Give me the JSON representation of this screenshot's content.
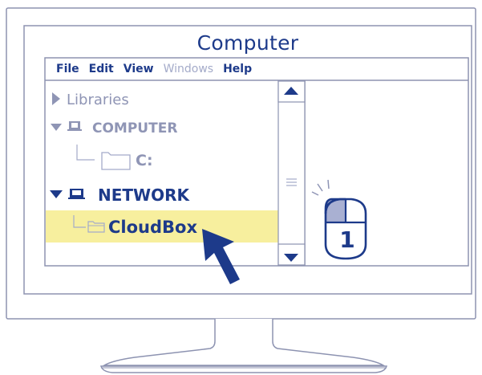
{
  "window": {
    "title": "Computer"
  },
  "menu": {
    "items": [
      {
        "label": "File",
        "enabled": true
      },
      {
        "label": "Edit",
        "enabled": true
      },
      {
        "label": "View",
        "enabled": true
      },
      {
        "label": "Windows",
        "enabled": false
      },
      {
        "label": "Help",
        "enabled": true
      }
    ]
  },
  "tree": {
    "libraries": {
      "label": "Libraries",
      "icon": "triangle-right-icon"
    },
    "computer": {
      "label": "COMPUTER",
      "icon": "monitor-icon"
    },
    "drive_c": {
      "label": "C:",
      "icon": "folder-icon"
    },
    "network": {
      "label": "NETWORK",
      "icon": "monitor-icon"
    },
    "cloudbox": {
      "label": "CloudBox",
      "icon": "folder-icon",
      "selected": true
    }
  },
  "mouse_hint": {
    "number": "1",
    "button": "left"
  },
  "colors": {
    "primary": "#1d3a8a",
    "muted": "#8f95b5",
    "disabled": "#a4abc9",
    "highlight": "#f7ef9e",
    "frame": "#8d93b1",
    "mouse_button": "#a9b0d2"
  }
}
